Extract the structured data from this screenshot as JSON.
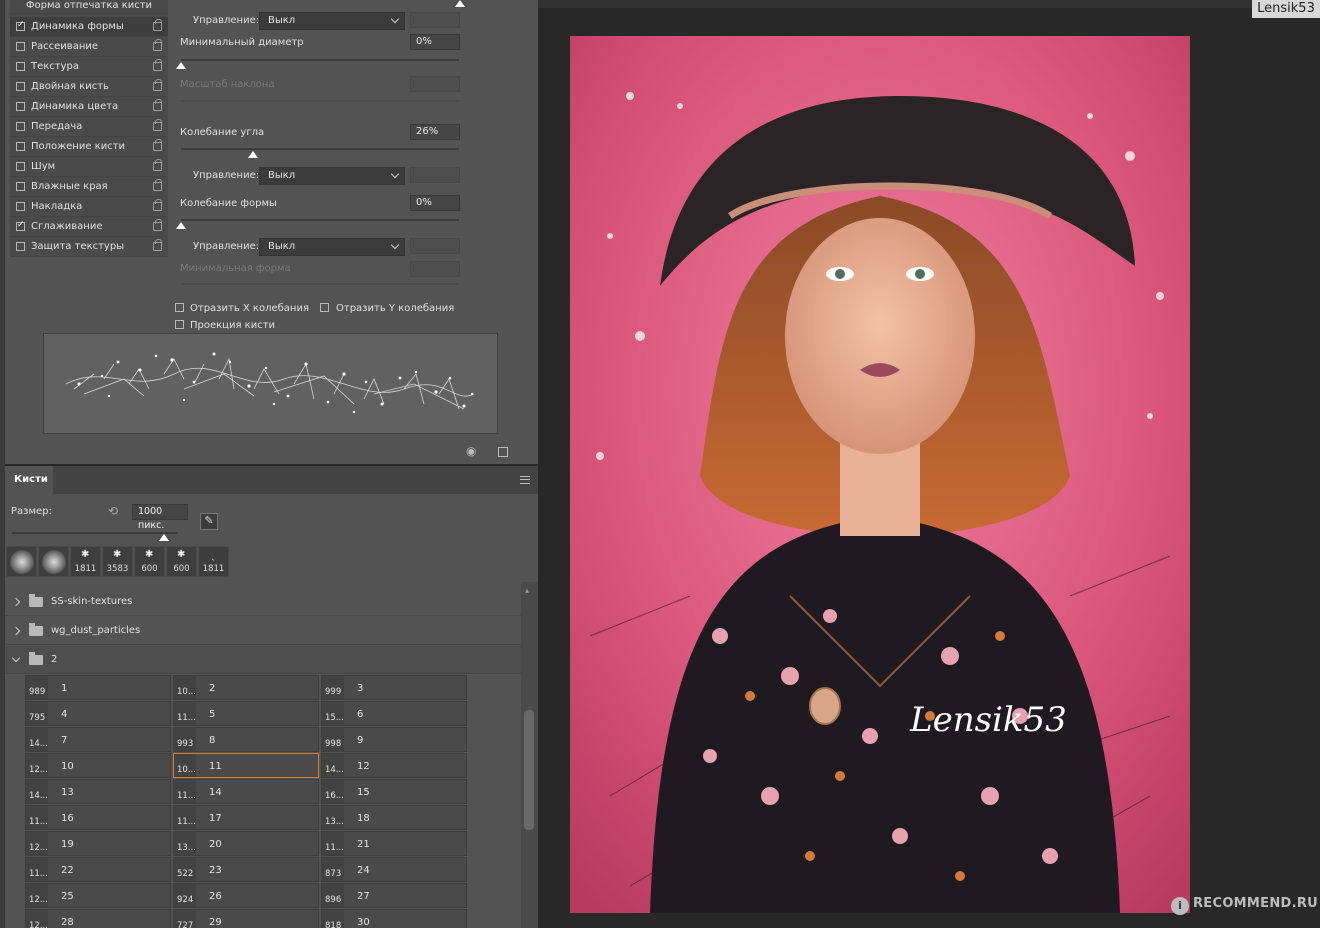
{
  "brush_settings": {
    "header": "Форма отпечатка кисти",
    "options": [
      {
        "label": "Динамика формы",
        "checked": true,
        "selected": true
      },
      {
        "label": "Рассеивание",
        "checked": false
      },
      {
        "label": "Текстура",
        "checked": false
      },
      {
        "label": "Двойная кисть",
        "checked": false
      },
      {
        "label": "Динамика цвета",
        "checked": false
      },
      {
        "label": "Передача",
        "checked": false
      },
      {
        "label": "Положение кисти",
        "checked": false
      },
      {
        "label": "Шум",
        "checked": false
      },
      {
        "label": "Влажные края",
        "checked": false
      },
      {
        "label": "Накладка",
        "checked": false
      },
      {
        "label": "Сглаживание",
        "checked": true
      },
      {
        "label": "Защита текстуры",
        "checked": false
      }
    ],
    "control_label": "Управление:",
    "control_value": "Выкл",
    "min_diameter_label": "Минимальный диаметр",
    "min_diameter_value": "0%",
    "tilt_scale_label": "Масштаб наклона",
    "angle_jitter_label": "Колебание угла",
    "angle_jitter_value": "26%",
    "roundness_jitter_label": "Колебание формы",
    "roundness_jitter_value": "0%",
    "min_roundness_label": "Минимальная форма",
    "flip_x_label": "Отразить X колебания",
    "flip_y_label": "Отразить Y колебания",
    "projection_label": "Проекция кисти",
    "angle_jitter_fraction": 0.26
  },
  "brushes_panel": {
    "tab_label": "Кисти",
    "size_label": "Размер:",
    "size_value": "1000 пикс.",
    "recent_tips": [
      "",
      "",
      "1811",
      "3583",
      "600",
      "600",
      "1811"
    ],
    "groups": [
      {
        "name": "SS-skin-textures",
        "open": false
      },
      {
        "name": "wg_dust_particles",
        "open": false
      },
      {
        "name": "2",
        "open": true
      }
    ],
    "brushes": [
      {
        "count": "989",
        "name": "1"
      },
      {
        "count": "10...",
        "name": "2"
      },
      {
        "count": "999",
        "name": "3"
      },
      {
        "count": "795",
        "name": "4"
      },
      {
        "count": "11...",
        "name": "5"
      },
      {
        "count": "15...",
        "name": "6"
      },
      {
        "count": "14...",
        "name": "7"
      },
      {
        "count": "993",
        "name": "8"
      },
      {
        "count": "998",
        "name": "9"
      },
      {
        "count": "12...",
        "name": "10"
      },
      {
        "count": "10...",
        "name": "11",
        "selected": true
      },
      {
        "count": "14...",
        "name": "12"
      },
      {
        "count": "14...",
        "name": "13"
      },
      {
        "count": "11...",
        "name": "14"
      },
      {
        "count": "16...",
        "name": "15"
      },
      {
        "count": "11...",
        "name": "16"
      },
      {
        "count": "11...",
        "name": "17"
      },
      {
        "count": "13...",
        "name": "18"
      },
      {
        "count": "12...",
        "name": "19"
      },
      {
        "count": "13...",
        "name": "20"
      },
      {
        "count": "11...",
        "name": "21"
      },
      {
        "count": "11...",
        "name": "22"
      },
      {
        "count": "522",
        "name": "23"
      },
      {
        "count": "873",
        "name": "24"
      },
      {
        "count": "12...",
        "name": "25"
      },
      {
        "count": "924",
        "name": "26"
      },
      {
        "count": "896",
        "name": "27"
      },
      {
        "count": "12...",
        "name": "28"
      },
      {
        "count": "727",
        "name": "29"
      },
      {
        "count": "818",
        "name": "30"
      }
    ]
  },
  "canvas": {
    "signature": "Lensik53",
    "user_tag": "Lensik53",
    "site_watermark": "RECOMMEND.RU",
    "site_badge": "i"
  },
  "colors": {
    "panel": "#535353",
    "canvas_background": "#282828",
    "artwork_pink": "#d9567a",
    "selection_orange": "#d67b2c"
  }
}
